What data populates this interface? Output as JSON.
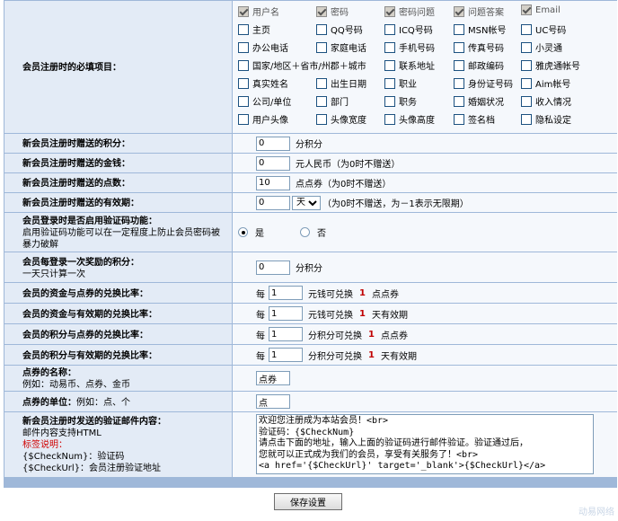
{
  "required_fields": {
    "label": "会员注册时的必填项目：",
    "options": [
      {
        "label": "用户名",
        "checked": true,
        "disabled": true
      },
      {
        "label": "密码",
        "checked": true,
        "disabled": true
      },
      {
        "label": "密码问题",
        "checked": true,
        "disabled": true
      },
      {
        "label": "问题答案",
        "checked": true,
        "disabled": true
      },
      {
        "label": "Email",
        "checked": true,
        "disabled": true
      },
      {
        "label": "主页",
        "checked": false
      },
      {
        "label": "QQ号码",
        "checked": false
      },
      {
        "label": "ICQ号码",
        "checked": false
      },
      {
        "label": "MSN帐号",
        "checked": false
      },
      {
        "label": "UC号码",
        "checked": false
      },
      {
        "label": "办公电话",
        "checked": false
      },
      {
        "label": "家庭电话",
        "checked": false
      },
      {
        "label": "手机号码",
        "checked": false
      },
      {
        "label": "传真号码",
        "checked": false
      },
      {
        "label": "小灵通",
        "checked": false
      },
      {
        "label": "国家/地区＋省市/州郡＋城市",
        "checked": false
      },
      {
        "label": "联系地址",
        "checked": false
      },
      {
        "label": "邮政编码",
        "checked": false
      },
      {
        "label": "雅虎通帐号",
        "checked": false
      },
      {
        "label": "真实姓名",
        "checked": false
      },
      {
        "label": "出生日期",
        "checked": false
      },
      {
        "label": "职业",
        "checked": false
      },
      {
        "label": "身份证号码",
        "checked": false
      },
      {
        "label": "Aim帐号",
        "checked": false
      },
      {
        "label": "公司/单位",
        "checked": false
      },
      {
        "label": "部门",
        "checked": false
      },
      {
        "label": "职务",
        "checked": false
      },
      {
        "label": "婚姻状况",
        "checked": false
      },
      {
        "label": "收入情况",
        "checked": false
      },
      {
        "label": "用户头像",
        "checked": false
      },
      {
        "label": "头像宽度",
        "checked": false
      },
      {
        "label": "头像高度",
        "checked": false
      },
      {
        "label": "签名档",
        "checked": false
      },
      {
        "label": "隐私设定",
        "checked": false
      }
    ]
  },
  "points_gift": {
    "label": "新会员注册时赠送的积分：",
    "value": "0",
    "unit": "分积分"
  },
  "money_gift": {
    "label": "新会员注册时赠送的金钱：",
    "value": "0",
    "unit": "元人民币（为0时不赠送）"
  },
  "coupon_gift": {
    "label": "新会员注册时赠送的点数：",
    "value": "10",
    "unit": "点点券（为0时不赠送）"
  },
  "validity_gift": {
    "label": "新会员注册时赠送的有效期：",
    "value": "0",
    "select": "天",
    "unit": "（为0时不赠送，为－1表示无限期）"
  },
  "captcha": {
    "label": "会员登录时是否启用验证码功能：",
    "sub": "启用验证码功能可以在一定程度上防止会员密码被暴力破解",
    "yes": "是",
    "no": "否",
    "selected": "yes"
  },
  "login_points": {
    "label": "会员每登录一次奖励的积分：",
    "sub": "一天只计算一次",
    "value": "0",
    "unit": "分积分"
  },
  "money_to_coupon": {
    "label": "会员的资金与点券的兑换比率：",
    "prefix": "每",
    "value": "1",
    "mid": "元钱可兑换",
    "num": "1",
    "unit": "点点券"
  },
  "money_to_validity": {
    "label": "会员的资金与有效期的兑换比率：",
    "prefix": "每",
    "value": "1",
    "mid": "元钱可兑换",
    "num": "1",
    "unit": "天有效期"
  },
  "points_to_coupon": {
    "label": "会员的积分与点券的兑换比率：",
    "prefix": "每",
    "value": "1",
    "mid": "分积分可兑换",
    "num": "1",
    "unit": "点点券"
  },
  "points_to_validity": {
    "label": "会员的积分与有效期的兑换比率：",
    "prefix": "每",
    "value": "1",
    "mid": "分积分可兑换",
    "num": "1",
    "unit": "天有效期"
  },
  "coupon_name": {
    "label": "点券的名称：",
    "sub": "例如：动易币、点券、金币",
    "value": "点券"
  },
  "coupon_unit": {
    "label": "点券的单位：",
    "sub": "例如：点、个",
    "value": "点"
  },
  "verify_mail": {
    "label": "新会员注册时发送的验证邮件内容：",
    "sub1": "邮件内容支持HTML",
    "tags_title": "标签说明：",
    "tag1": "{$CheckNum}：验证码",
    "tag2": "{$CheckUrl}：会员注册验证地址",
    "content": "欢迎您注册成为本站会员！<br>\n验证码：{$CheckNum}\n请点击下面的地址，输入上面的验证码进行邮件验证。验证通过后，\n您就可以正式成为我们的会员，享受有关服务了！<br>\n<a href='{$CheckUrl}' target='_blank'>{$CheckUrl}</a>"
  },
  "save_button": "保存设置",
  "watermark": "动易网络"
}
